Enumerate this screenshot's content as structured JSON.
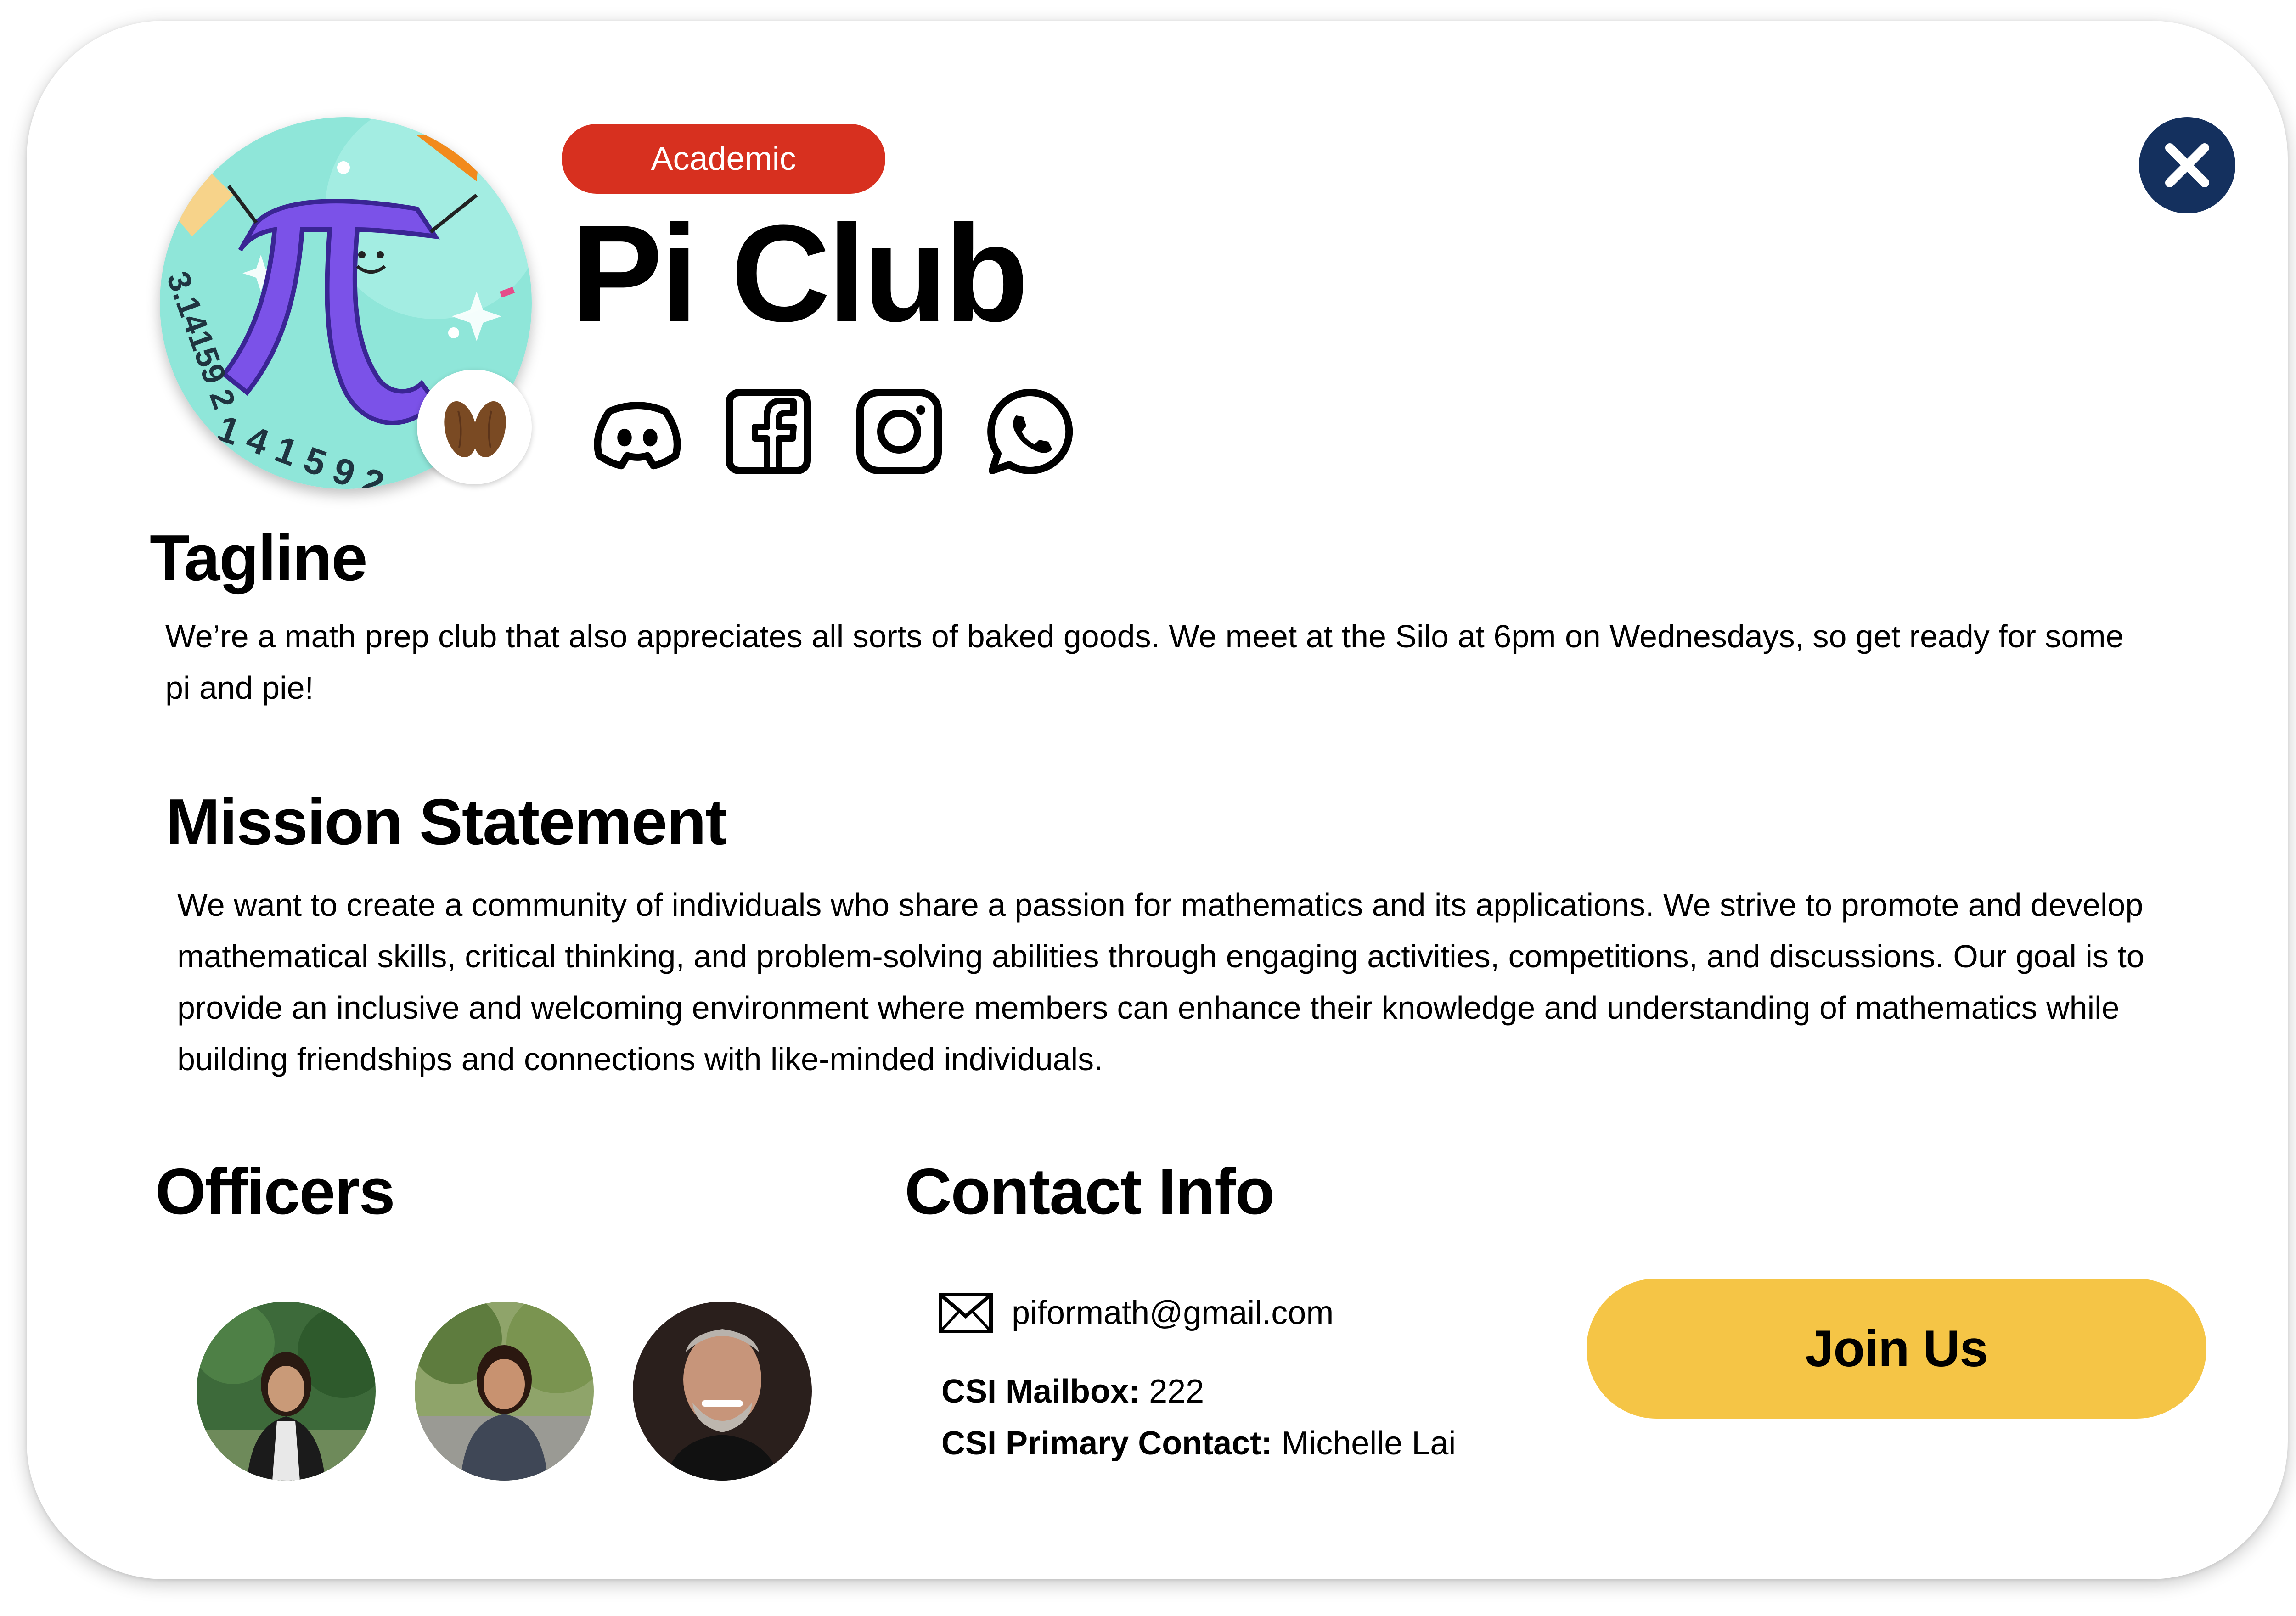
{
  "club": {
    "category": "Academic",
    "name": "Pi Club",
    "logo_text": "3.14159 2",
    "socials": [
      "discord-icon",
      "facebook-icon",
      "instagram-icon",
      "whatsapp-icon"
    ]
  },
  "tagline": {
    "heading": "Tagline",
    "text": "We’re a math prep club that also appreciates all sorts of baked goods. We meet at the Silo at 6pm on Wednesdays, so get ready for some pi and pie!"
  },
  "mission": {
    "heading": "Mission Statement",
    "text": "We want to create a community of individuals who share a passion for mathematics and its applications. We strive to promote and develop mathematical skills, critical thinking, and problem-solving abilities through engaging activities, competitions, and discussions. Our goal is to provide an inclusive and welcoming environment where members can enhance their knowledge and understanding of mathematics while building friendships and connections with like-minded individuals."
  },
  "officers": {
    "heading": "Officers"
  },
  "contact": {
    "heading": "Contact Info",
    "email": "piformath@gmail.com",
    "mailbox_label": "CSI Mailbox:",
    "mailbox_value": "222",
    "primary_label": "CSI Primary Contact:",
    "primary_value": "Michelle Lai"
  },
  "actions": {
    "join_label": "Join Us"
  },
  "colors": {
    "category_pill": "#D7301F",
    "close_button": "#14305E",
    "join_button": "#F5C546",
    "logo_bg": "#8FE6D9"
  }
}
